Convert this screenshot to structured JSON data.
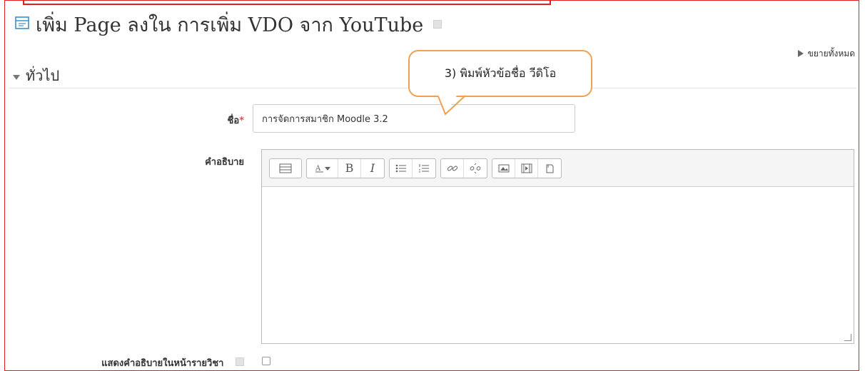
{
  "page": {
    "title": "เพิ่ม Page ลงใน การเพิ่ม VDO จาก YouTube",
    "expand_all": "ขยายทั้งหมด"
  },
  "section": {
    "title": "ทั่วไป"
  },
  "form": {
    "name_label": "ชื่อ",
    "name_required_marker": "*",
    "name_value": "การจัดการสมาชิก Moodle 3.2",
    "description_label": "คำอธิบาย",
    "show_description_label": "แสดงคำอธิบายในหน้ารายวิชา"
  },
  "toolbar": {
    "buttons": [
      "toolbar-toggle-icon",
      "font-color-icon",
      "bold-icon",
      "italic-icon",
      "bullet-list-icon",
      "numbered-list-icon",
      "link-icon",
      "unlink-icon",
      "image-icon",
      "media-icon",
      "manage-files-icon"
    ],
    "bold_glyph": "B",
    "italic_glyph": "I"
  },
  "callout": {
    "text": "3) พิมพ์หัวข้อชื่อ วีดิโอ"
  }
}
